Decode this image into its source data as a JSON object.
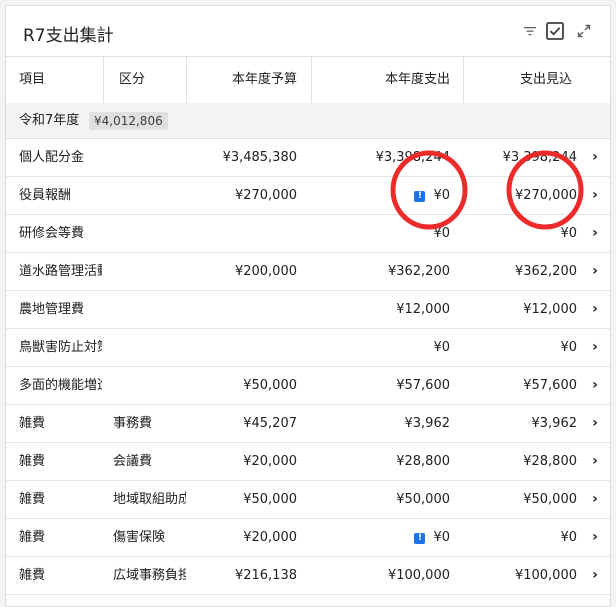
{
  "widget": {
    "title": "R7支出集計"
  },
  "columns": {
    "item": "項目",
    "category": "区分",
    "budget": "本年度予算",
    "spend": "本年度支出",
    "projection": "支出見込"
  },
  "group": {
    "label": "令和7年度",
    "total": "¥4,012,806"
  },
  "rows": [
    {
      "item": "個人配分金",
      "category": "",
      "budget": "¥3,485,380",
      "spend": "¥3,398,244",
      "projection": "¥3,398,244",
      "warning": false
    },
    {
      "item": "役員報酬",
      "category": "",
      "budget": "¥270,000",
      "spend": "¥0",
      "projection": "¥270,000",
      "warning": true
    },
    {
      "item": "研修会等費",
      "category": "",
      "budget": "",
      "spend": "¥0",
      "projection": "¥0",
      "warning": false
    },
    {
      "item": "道水路管理活動",
      "category": "",
      "budget": "¥200,000",
      "spend": "¥362,200",
      "projection": "¥362,200",
      "warning": false
    },
    {
      "item": "農地管理費",
      "category": "",
      "budget": "",
      "spend": "¥12,000",
      "projection": "¥12,000",
      "warning": false
    },
    {
      "item": "鳥獣害防止対策",
      "category": "",
      "budget": "",
      "spend": "¥0",
      "projection": "¥0",
      "warning": false
    },
    {
      "item": "多面的機能増進",
      "category": "",
      "budget": "¥50,000",
      "spend": "¥57,600",
      "projection": "¥57,600",
      "warning": false
    },
    {
      "item": "雑費",
      "category": "事務費",
      "budget": "¥45,207",
      "spend": "¥3,962",
      "projection": "¥3,962",
      "warning": false
    },
    {
      "item": "雑費",
      "category": "会議費",
      "budget": "¥20,000",
      "spend": "¥28,800",
      "projection": "¥28,800",
      "warning": false
    },
    {
      "item": "雑費",
      "category": "地域取組助成",
      "budget": "¥50,000",
      "spend": "¥50,000",
      "projection": "¥50,000",
      "warning": false
    },
    {
      "item": "雑費",
      "category": "傷害保険",
      "budget": "¥20,000",
      "spend": "¥0",
      "projection": "¥0",
      "warning": true
    },
    {
      "item": "雑費",
      "category": "広域事務負担",
      "budget": "¥216,138",
      "spend": "¥100,000",
      "projection": "¥100,000",
      "warning": false
    }
  ],
  "icons": {
    "filter": "filter-icon",
    "check": "checkbox-icon",
    "expand": "expand-icon",
    "warning": "info-icon",
    "chevron": "chevron-right-icon"
  },
  "colors": {
    "accent": "#1a73e8",
    "annotation": "#ee2b2b"
  }
}
